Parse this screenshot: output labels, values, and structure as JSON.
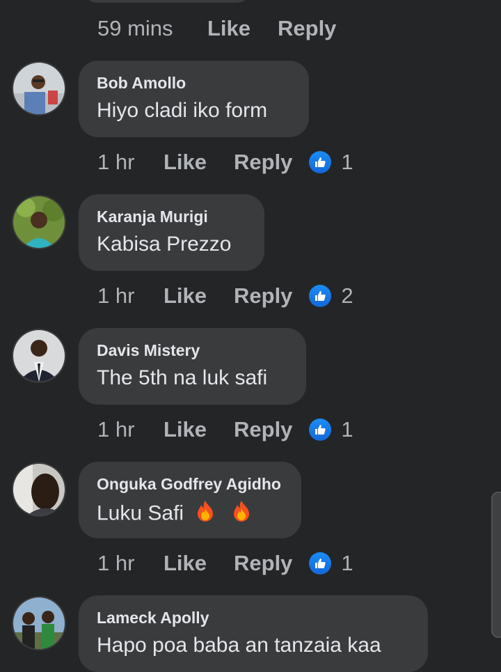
{
  "top_comment_meta": {
    "time": "59 mins",
    "like": "Like",
    "reply": "Reply"
  },
  "comments": [
    {
      "author": "Bob Amollo",
      "text": "Hiyo cladi iko form",
      "time": "1 hr",
      "like": "Like",
      "reply": "Reply",
      "reactions": "1"
    },
    {
      "author": "Karanja Murigi",
      "text": "Kabisa Prezzo",
      "time": "1 hr",
      "like": "Like",
      "reply": "Reply",
      "reactions": "2"
    },
    {
      "author": "Davis Mistery",
      "text": "The 5th na luk safi",
      "time": "1 hr",
      "like": "Like",
      "reply": "Reply",
      "reactions": "1"
    },
    {
      "author": "Onguka Godfrey Agidho",
      "text": "Luku Safi",
      "time": "1 hr",
      "like": "Like",
      "reply": "Reply",
      "reactions": "1"
    },
    {
      "author": "Lameck Apolly",
      "text": "Hapo poa baba an tanzaia kaa"
    }
  ],
  "icons": {
    "reaction": "thumbs-up-icon",
    "emoji": "fire-emoji"
  },
  "colors": {
    "background": "#242526",
    "bubble": "#3a3b3c",
    "meta_text": "#b0b3b8",
    "like_blue": "#1877f2"
  }
}
